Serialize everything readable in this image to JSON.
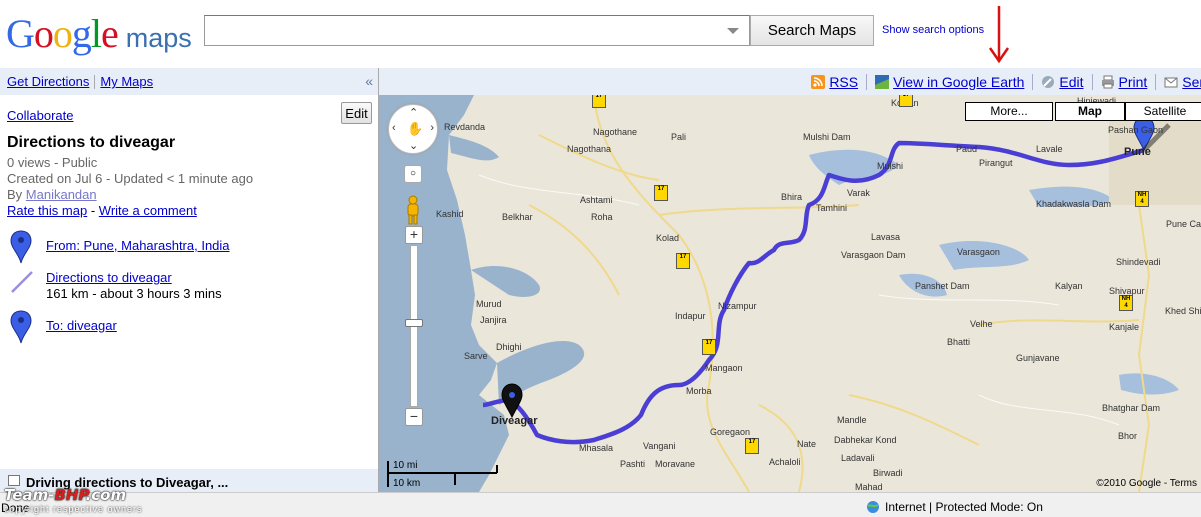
{
  "header": {
    "logo_google": "Google",
    "logo_maps": "maps",
    "search_value": "",
    "search_button": "Search Maps",
    "search_options": "Show search options"
  },
  "leftnav": {
    "get_directions": "Get Directions",
    "my_maps": "My Maps",
    "collapse": "«"
  },
  "panel": {
    "collaborate": "Collaborate",
    "edit": "Edit",
    "title": "Directions to diveagar",
    "views": "0 views - Public",
    "created": "Created on Jul 6 - Updated < 1 minute ago",
    "by_prefix": "By",
    "author": "Manikandan",
    "rate": "Rate this map",
    "rate_sep": "-",
    "comment": "Write a comment",
    "from": "From: Pune, Maharashtra, India",
    "route_link": "Directions to diveagar",
    "route_info": "161 km - about 3 hours 3 mins",
    "to": "To: diveagar"
  },
  "leftfoot": {
    "text": "Driving directions to Diveagar, ..."
  },
  "toolbar": {
    "rss": "RSS",
    "earth": "View in Google Earth",
    "edit": "Edit",
    "print": "Print",
    "send": "Send"
  },
  "maptype": {
    "more": "More...",
    "map": "Map",
    "satellite": "Satellite"
  },
  "map": {
    "towns": [
      {
        "name": "Revdanda"
      },
      {
        "name": "Nagothane"
      },
      {
        "name": "Pali"
      },
      {
        "name": "Kolvan"
      },
      {
        "name": "Hinjewadi"
      },
      {
        "name": "Mulshi Dam"
      },
      {
        "name": "Nagothana"
      },
      {
        "name": "Mulshi"
      },
      {
        "name": "Paud"
      },
      {
        "name": "Pirangut"
      },
      {
        "name": "Lavale"
      },
      {
        "name": "Pashan Gaon"
      },
      {
        "name": "Pune"
      },
      {
        "name": "Ashtami"
      },
      {
        "name": "Roha"
      },
      {
        "name": "Bhira"
      },
      {
        "name": "Varak"
      },
      {
        "name": "Tamhini"
      },
      {
        "name": "Kashid"
      },
      {
        "name": "Belkhar"
      },
      {
        "name": "Khadakwasla Dam"
      },
      {
        "name": "Kolad"
      },
      {
        "name": "Lavasa"
      },
      {
        "name": "Varasgaon"
      },
      {
        "name": "Varasgaon Dam"
      },
      {
        "name": "Pune Cantonment"
      },
      {
        "name": "Shindevadi"
      },
      {
        "name": "Panshet Dam"
      },
      {
        "name": "Nizampur"
      },
      {
        "name": "Murud"
      },
      {
        "name": "Kalyan"
      },
      {
        "name": "Shivapur"
      },
      {
        "name": "Indapur"
      },
      {
        "name": "Janjira"
      },
      {
        "name": "Kanjale"
      },
      {
        "name": "Velhe"
      },
      {
        "name": "Khed Shivapur"
      },
      {
        "name": "Dhighi"
      },
      {
        "name": "Bhatti"
      },
      {
        "name": "Sarve"
      },
      {
        "name": "Gunjavane"
      },
      {
        "name": "Mangaon"
      },
      {
        "name": "Morba"
      },
      {
        "name": "Bhatghar Dam"
      },
      {
        "name": "Diveagar"
      },
      {
        "name": "Mandle"
      },
      {
        "name": "Goregaon"
      },
      {
        "name": "Bhor"
      },
      {
        "name": "Mhasala"
      },
      {
        "name": "Vangani"
      },
      {
        "name": "Dabhekar Kond"
      },
      {
        "name": "Nate"
      },
      {
        "name": "Pashti"
      },
      {
        "name": "Moravane"
      },
      {
        "name": "Achaloli"
      },
      {
        "name": "Ladavali"
      },
      {
        "name": "Birwadi"
      },
      {
        "name": "Mahad"
      }
    ],
    "shields": [
      "17",
      "17",
      "17",
      "17",
      "NH 4",
      "17",
      "17",
      "NH 4"
    ],
    "scale_mi": "10 mi",
    "scale_km": "10 km",
    "copyright": "©2010 Google - Terms"
  },
  "status": {
    "done": "Done",
    "zone": "Internet | Protected Mode: On"
  },
  "watermark": {
    "team": "Team-",
    "bhp": "BHP",
    "com": ".com",
    "sub": "copyright respective owners"
  }
}
